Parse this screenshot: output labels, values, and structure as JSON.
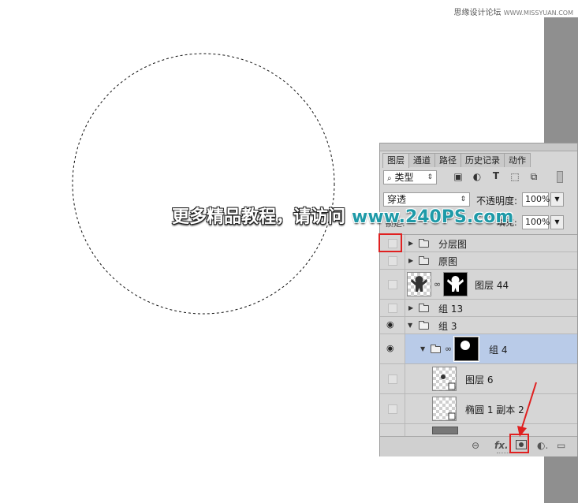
{
  "watermark": {
    "left": "思缘设计论坛",
    "right": "WWW.MISSYUAN.COM"
  },
  "overlay": {
    "text": "更多精品教程，请访问",
    "url": "www.240PS.com"
  },
  "panel": {
    "tabs": [
      "图层",
      "通道",
      "路径",
      "历史记录",
      "动作"
    ],
    "filter_kind": "类型",
    "blend_mode": "穿透",
    "opacity_label": "不透明度:",
    "opacity_value": "100%",
    "fill_label": "填充:",
    "fill_value": "100%",
    "lock_label": "锁定:"
  },
  "layers": [
    {
      "name": "分层图",
      "type": "group",
      "visible": false,
      "expanded": false
    },
    {
      "name": "原图",
      "type": "group",
      "visible": false,
      "expanded": false
    },
    {
      "name": "图层 44",
      "type": "layer-with-mask",
      "visible": false
    },
    {
      "name": "组 13",
      "type": "group",
      "visible": false,
      "expanded": false
    },
    {
      "name": "组 3",
      "type": "group",
      "visible": true,
      "expanded": true
    },
    {
      "name": "组 4",
      "type": "group-with-mask",
      "visible": true,
      "expanded": true,
      "selected": true
    },
    {
      "name": "图层 6",
      "type": "smart-object",
      "visible": false
    },
    {
      "name": "椭圆 1 副本 2",
      "type": "shape",
      "visible": false
    }
  ],
  "colors": {
    "selected_row": "#b9cbe8",
    "highlight": "#e02020",
    "url": "#1e9aa8"
  },
  "icons": {
    "bottom": [
      "link-icon",
      "fx-icon",
      "add-mask-icon",
      "adjustment-icon",
      "new-group-icon"
    ]
  }
}
